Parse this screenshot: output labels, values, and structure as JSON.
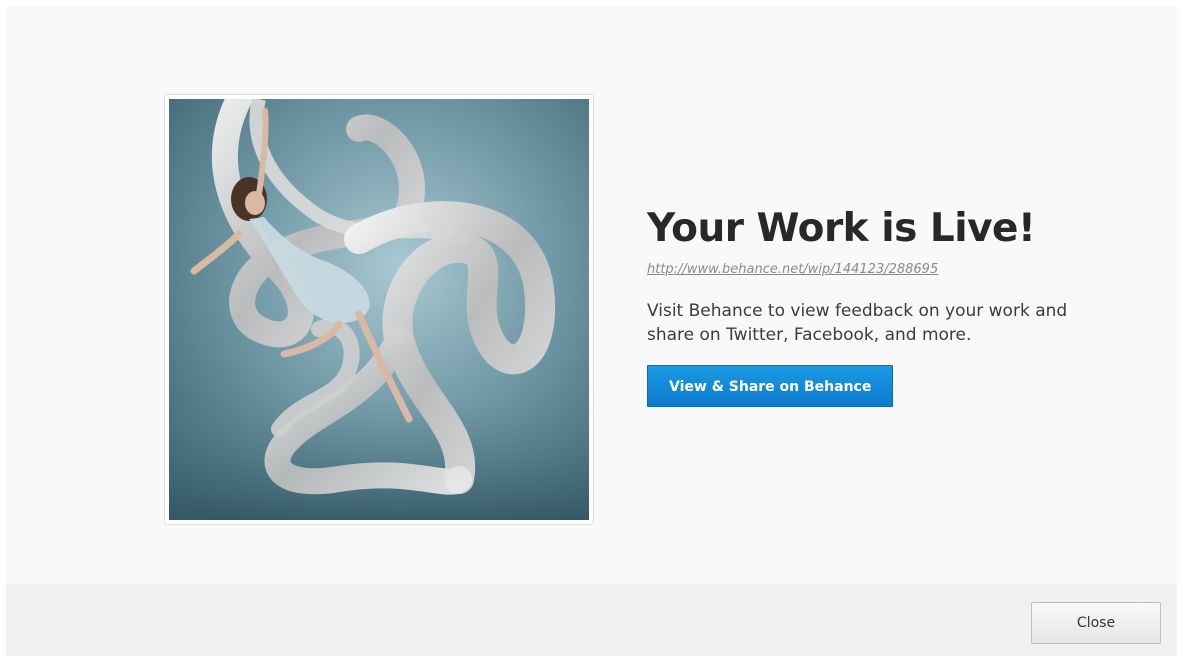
{
  "dialog": {
    "title": "Your Work is Live!",
    "url": "http://www.behance.net/wip/144123/288695",
    "description": "Visit Behance to view feedback on your work and share on Twitter, Facebook, and more.",
    "primary_button_label": "View & Share on Behance",
    "accent_color": "#1589d9"
  },
  "footer": {
    "close_label": "Close"
  },
  "thumbnail": {
    "icon": "artwork-thumbnail-dancer-with-ribbons"
  }
}
